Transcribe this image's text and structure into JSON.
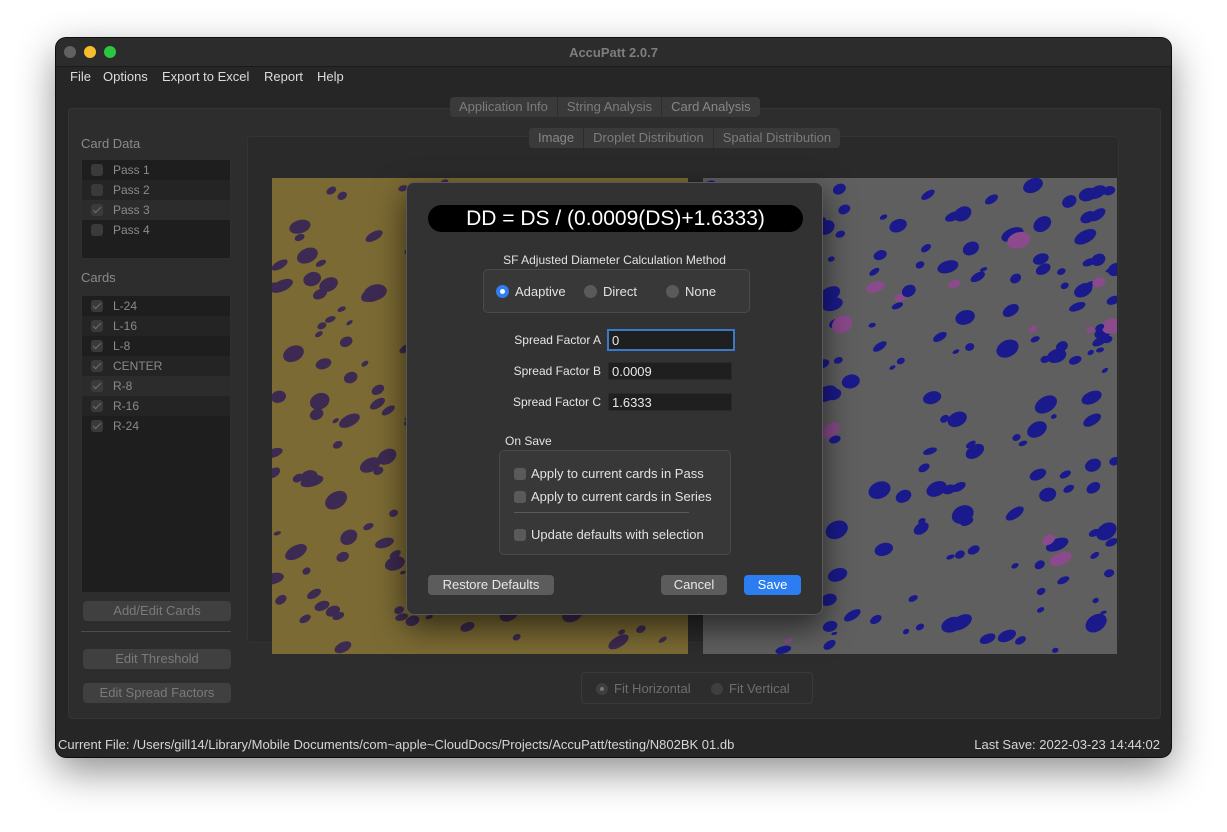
{
  "window": {
    "title": "AccuPatt 2.0.7"
  },
  "menu": [
    "File",
    "Options",
    "Export to Excel",
    "Report",
    "Help"
  ],
  "main_tabs": [
    "Application Info",
    "String Analysis",
    "Card Analysis"
  ],
  "sub_tabs": [
    "Image",
    "Droplet Distribution",
    "Spatial Distribution"
  ],
  "card_data": {
    "label": "Card Data",
    "passes": [
      {
        "label": "Pass 1",
        "checked": false
      },
      {
        "label": "Pass 2",
        "checked": false
      },
      {
        "label": "Pass 3",
        "checked": true
      },
      {
        "label": "Pass 4",
        "checked": false
      }
    ]
  },
  "cards": {
    "label": "Cards",
    "items": [
      {
        "label": "L-24",
        "checked": true
      },
      {
        "label": "L-16",
        "checked": true
      },
      {
        "label": "L-8",
        "checked": true
      },
      {
        "label": "CENTER",
        "checked": true
      },
      {
        "label": "R-8",
        "checked": true
      },
      {
        "label": "R-16",
        "checked": true
      },
      {
        "label": "R-24",
        "checked": true
      }
    ]
  },
  "sidebar_buttons": {
    "add_edit": "Add/Edit Cards",
    "threshold": "Edit Threshold",
    "spread": "Edit Spread Factors"
  },
  "fit": {
    "horizontal": "Fit Horizontal",
    "vertical": "Fit Vertical",
    "selected": "horizontal"
  },
  "status": {
    "file": "Current File: /Users/gill14/Library/Mobile Documents/com~apple~CloudDocs/Projects/AccuPatt/testing/N802BK 01.db",
    "last_save": "Last Save: 2022-03-23 14:44:02"
  },
  "dialog": {
    "formula": "DD = DS / (0.0009(DS)+1.6333)",
    "method_title": "SF Adjusted Diameter Calculation Method",
    "methods": [
      "Adaptive",
      "Direct",
      "None"
    ],
    "selected_method": "Adaptive",
    "spread_a_label": "Spread Factor A",
    "spread_a": "0",
    "spread_b_label": "Spread Factor B",
    "spread_b": "0.0009",
    "spread_c_label": "Spread Factor C",
    "spread_c": "1.6333",
    "on_save_title": "On Save",
    "apply_pass": "Apply to current cards in Pass",
    "apply_series": "Apply to current cards in Series",
    "update_defaults": "Update defaults with selection",
    "restore_defaults": "Restore Defaults",
    "cancel": "Cancel",
    "save": "Save"
  },
  "colors": {
    "card_background": "#7b6a33",
    "stain": "#3d2a52",
    "mask_background": "#5f5f5f",
    "mask_droplet": "#1a1a8c",
    "mask_edge": "#8a4a8c",
    "accent": "#2c7df0"
  }
}
